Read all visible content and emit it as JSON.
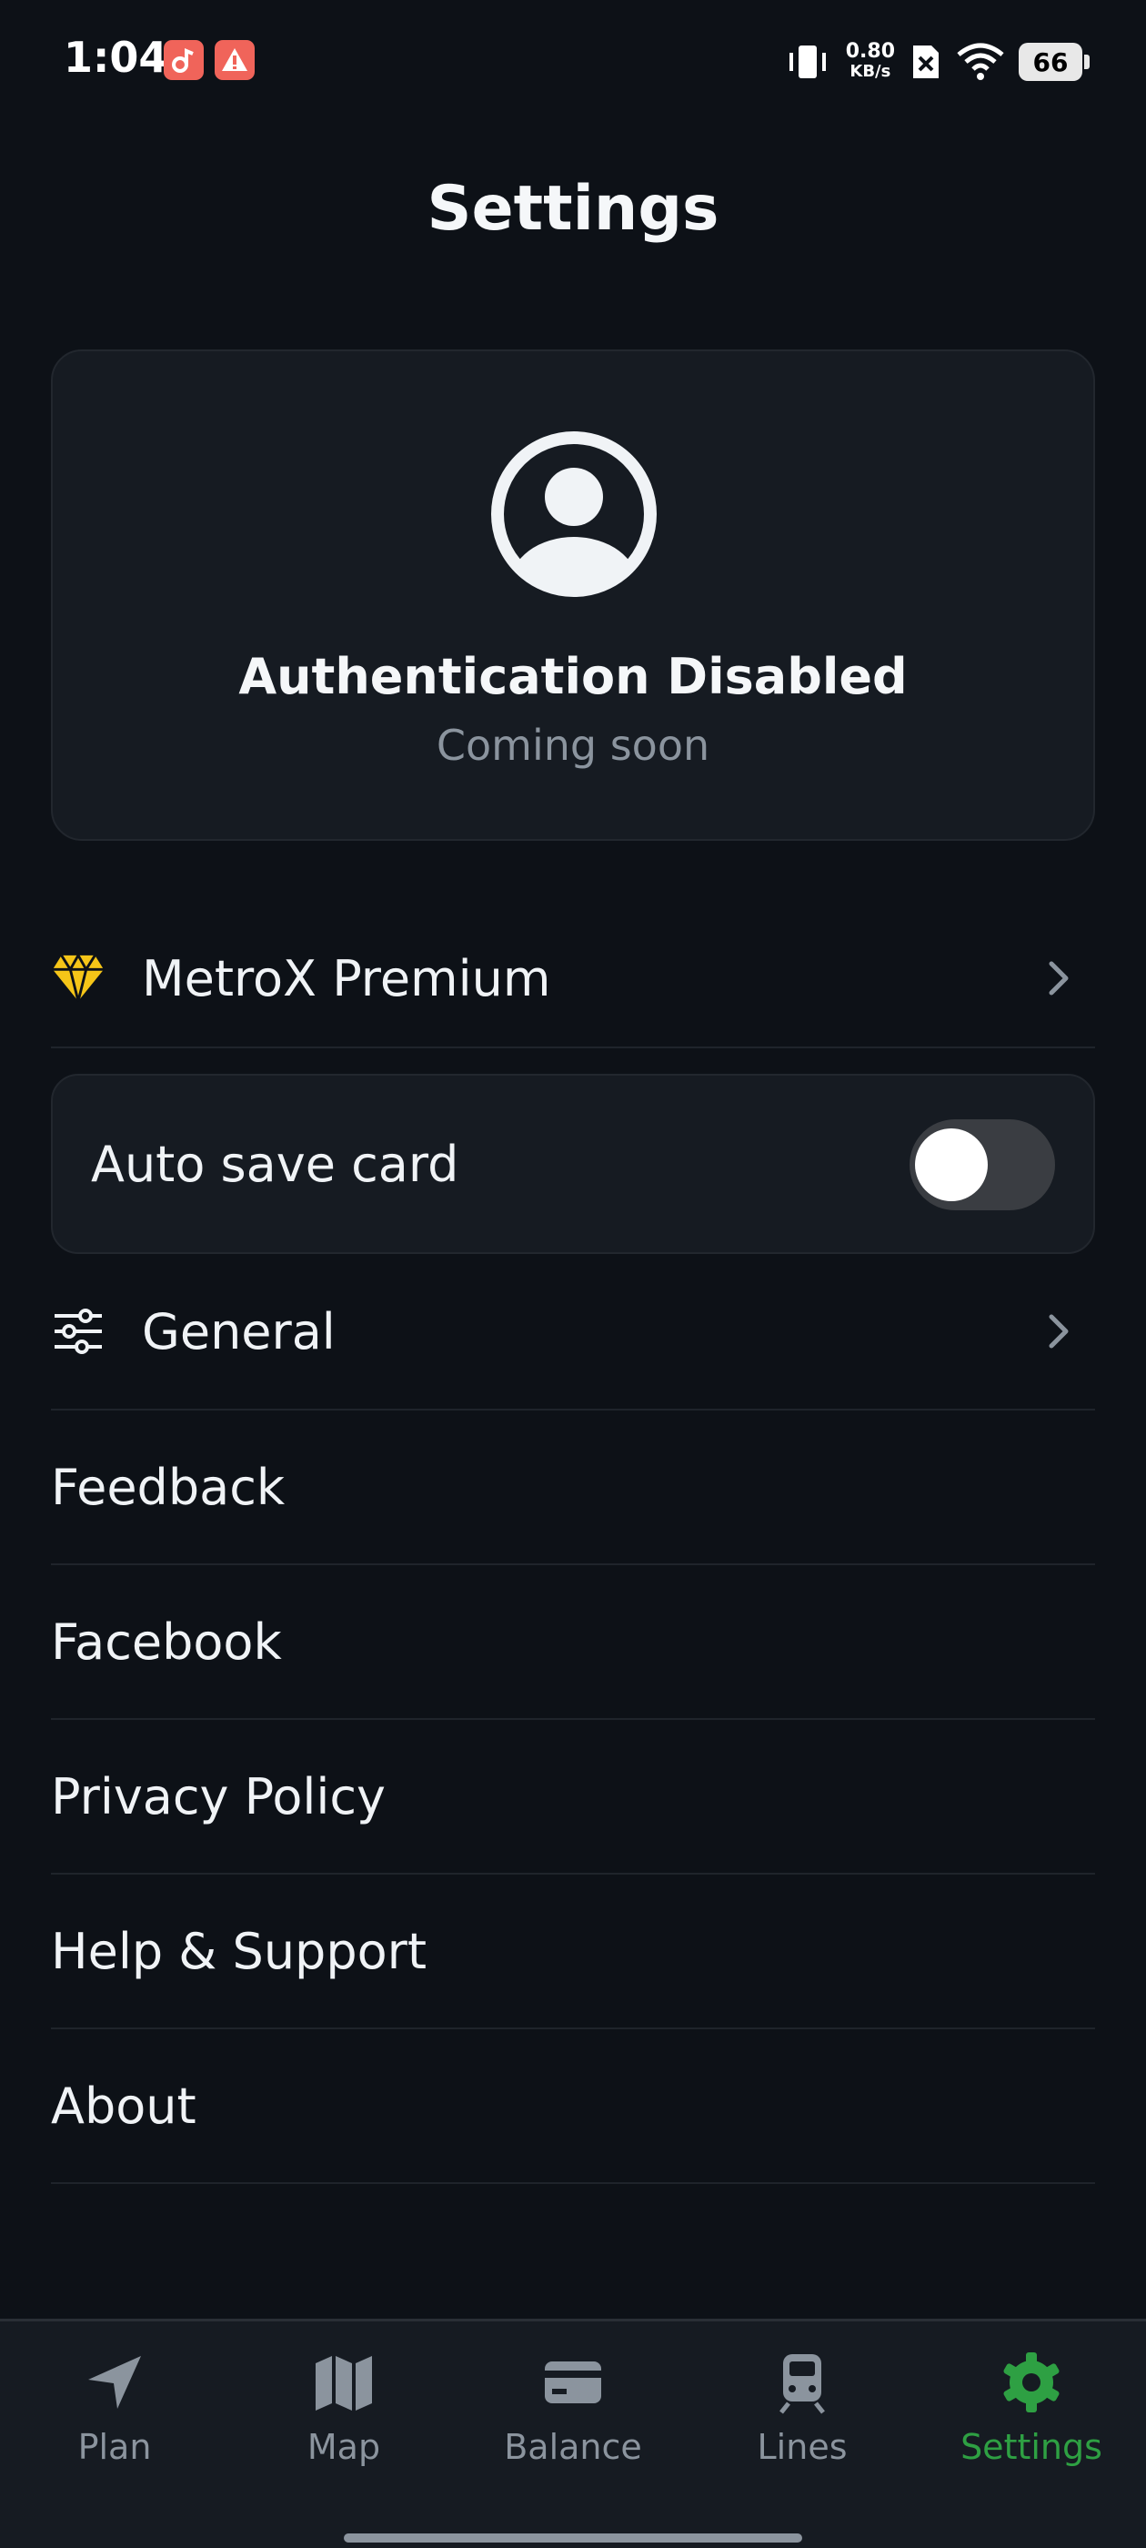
{
  "status_bar": {
    "time": "1:04",
    "speed_value": "0.80",
    "speed_unit": "KB/s",
    "battery": "66",
    "icons": [
      "music-app-icon",
      "warning-app-icon",
      "vibrate-icon",
      "no-sim-icon",
      "wifi-icon",
      "battery-icon"
    ]
  },
  "page": {
    "title": "Settings"
  },
  "auth_card": {
    "title": "Authentication Disabled",
    "subtitle": "Coming soon",
    "icon": "user-avatar-icon"
  },
  "menu": {
    "premium": {
      "label": "MetroX Premium",
      "icon": "diamond-icon",
      "icon_color": "#f5c518"
    },
    "auto_save": {
      "label": "Auto save card",
      "enabled": false
    },
    "general": {
      "label": "General",
      "icon": "sliders-icon"
    },
    "links": [
      {
        "label": "Feedback"
      },
      {
        "label": "Facebook"
      },
      {
        "label": "Privacy Policy"
      },
      {
        "label": "Help & Support"
      },
      {
        "label": "About"
      }
    ]
  },
  "bottom_nav": {
    "items": [
      {
        "label": "Plan",
        "icon": "navigation-arrow-icon"
      },
      {
        "label": "Map",
        "icon": "map-icon"
      },
      {
        "label": "Balance",
        "icon": "card-icon"
      },
      {
        "label": "Lines",
        "icon": "train-icon"
      },
      {
        "label": "Settings",
        "icon": "gear-icon",
        "active": true
      }
    ],
    "active_color": "#2ea043",
    "inactive_color": "#8b949e"
  }
}
